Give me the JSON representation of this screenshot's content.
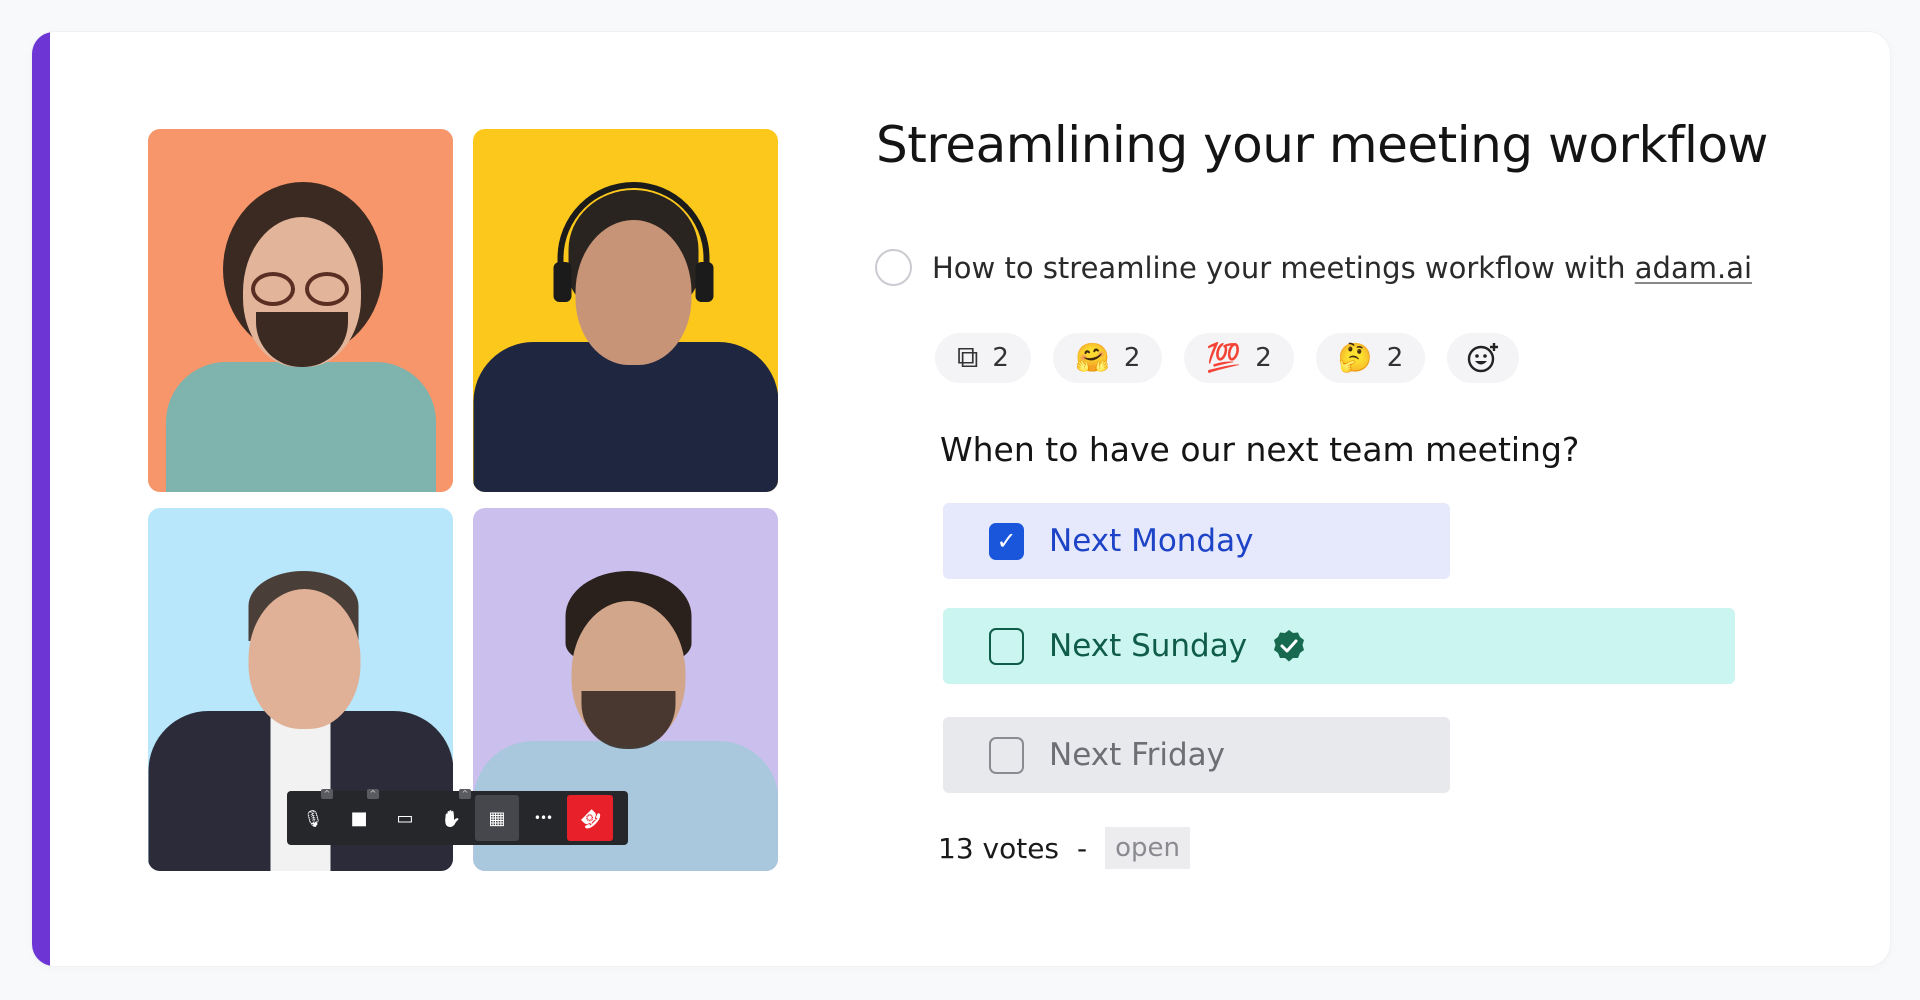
{
  "colors": {
    "accent": "#6c35d4",
    "poll_selected_bg": "#e6e8fb",
    "poll_selected_text": "#1d43c7",
    "poll_winner_bg": "#cbf5f0",
    "poll_winner_text": "#0f5c4a",
    "poll_default_bg": "#e8e9ec",
    "end_call": "#e8202a"
  },
  "video_call": {
    "tiles": [
      {
        "name": "participant-1",
        "background": "#f7966b"
      },
      {
        "name": "participant-2",
        "background": "#fcc81c"
      },
      {
        "name": "participant-3",
        "background": "#b8e6fb"
      },
      {
        "name": "participant-4",
        "background": "#cbbfee"
      }
    ],
    "controls": [
      {
        "icon": "microphone-icon",
        "glyph": "🎙",
        "has_menu": true,
        "menu_glyph": "^"
      },
      {
        "icon": "camera-icon",
        "glyph": "■",
        "has_menu": true,
        "menu_glyph": "^"
      },
      {
        "icon": "screen-share-icon",
        "glyph": "▭",
        "has_menu": false
      },
      {
        "icon": "raise-hand-icon",
        "glyph": "✋",
        "has_menu": true,
        "menu_glyph": "^"
      },
      {
        "icon": "grid-view-icon",
        "glyph": "▦",
        "has_menu": false,
        "active": true
      },
      {
        "icon": "more-options-icon",
        "glyph": "•••",
        "has_menu": false
      },
      {
        "icon": "end-call-icon",
        "glyph": "☎",
        "has_menu": false
      }
    ]
  },
  "content": {
    "title": "Streamlining your meeting workflow",
    "task": {
      "text": "How to streamline your meetings workflow with ",
      "link": "adam.ai",
      "completed": false
    },
    "reactions": [
      {
        "icon": "copy-icon",
        "emoji": "⧉",
        "count": "2"
      },
      {
        "icon": "hugging-face-icon",
        "emoji": "🤗",
        "count": "2"
      },
      {
        "icon": "hundred-points-icon",
        "emoji": "💯",
        "count": "2"
      },
      {
        "icon": "thinking-face-icon",
        "emoji": "🤔",
        "count": "2"
      }
    ],
    "add_reaction_icon": "add-reaction-icon",
    "poll": {
      "question": "When to have our next team meeting?",
      "options": [
        {
          "label": "Next Monday",
          "checked": true,
          "verified": false
        },
        {
          "label": "Next Sunday",
          "checked": false,
          "verified": true
        },
        {
          "label": "Next Friday",
          "checked": false,
          "verified": false
        }
      ],
      "votes": "13 votes",
      "separator": "-",
      "status": "open"
    }
  }
}
